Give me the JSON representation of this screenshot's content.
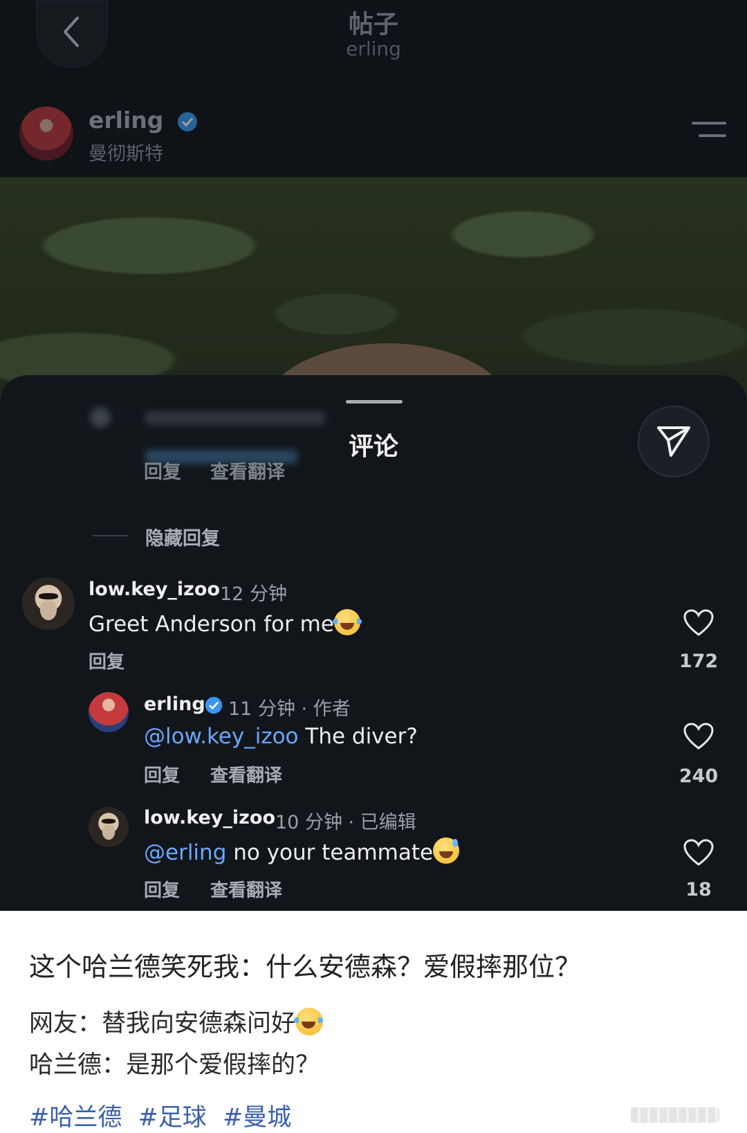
{
  "nav": {
    "title": "帖子",
    "subtitle": "erling"
  },
  "post": {
    "username": "erling",
    "location": "曼彻斯特"
  },
  "sheet": {
    "title": "评论",
    "faded_reply": "回复",
    "faded_translate": "查看翻译",
    "hide_replies": "隐藏回复"
  },
  "comments": [
    {
      "username": "low.key_izoo",
      "time": "12 分钟",
      "text": "Greet Anderson for me",
      "reply": "回复",
      "likes": "172"
    },
    {
      "username": "erling",
      "time": "11 分钟 · 作者",
      "mention": "@low.key_izoo",
      "text": " The diver?",
      "reply": "回复",
      "translate": "查看翻译",
      "likes": "240"
    },
    {
      "username": "low.key_izoo",
      "time": "10 分钟 · 已编辑",
      "mention": "@erling",
      "text": " no your teammate",
      "reply": "回复",
      "translate": "查看翻译",
      "likes": "18"
    }
  ],
  "caption": {
    "title": "这个哈兰德笑死我：什么安德森？爱假摔那位？",
    "line1": "网友：替我向安德森问好",
    "line2": "哈兰德：是那个爱假摔的？",
    "tags": [
      "#哈兰德",
      "#足球",
      "#曼城"
    ]
  },
  "colors": {
    "background": "#0f1216",
    "mention": "#6aa8ff",
    "verified": "#3897f0",
    "hashtag": "#3a5fae"
  },
  "icons": [
    "chevron-left-icon",
    "verified-icon",
    "menu-icon",
    "send-icon",
    "heart-icon",
    "laughing-emoji",
    "sweat-smile-emoji"
  ]
}
